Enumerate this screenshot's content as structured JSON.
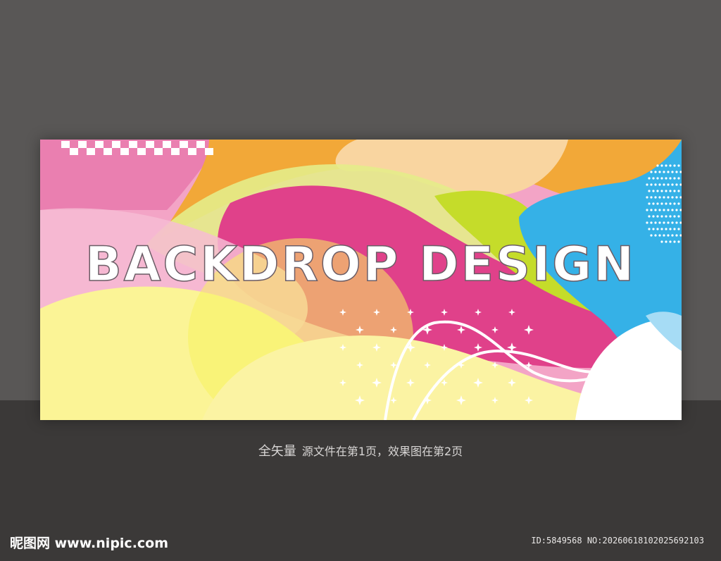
{
  "banner": {
    "headline": "BACKDROP DESIGN",
    "colors": {
      "pink": "#e0418a",
      "light_pink": "#f3a4c6",
      "orange": "#f2a838",
      "peach": "#f9d5a0",
      "lime": "#c5dc2a",
      "yellow": "#fbf496",
      "blue": "#35b1e7",
      "white": "#ffffff"
    }
  },
  "caption": {
    "lead": "全矢量",
    "text": "源文件在第1页，效果图在第2页"
  },
  "watermark": {
    "logo": "昵图网 www.nipic.com",
    "id": "ID:5849568 NO:20260618102025692103"
  }
}
